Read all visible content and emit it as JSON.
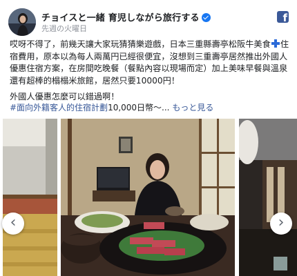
{
  "post": {
    "page_name": "チョイスと一緒 育児しながら旅行する",
    "time": "先週の火曜日",
    "facebook_logo_letter": "f",
    "body_part1": "哎呀不得了，前幾天讓大家玩猜猜樂遊戲，日本三重縣壽亭松阪牛美食",
    "body_part2": "住宿費用，原本以為每人兩萬円已經很便宜，沒想到三重壽亭居然推出外國人優惠住宿方案，在房間吃晚餐（餐點內容以現場而定）加上美味早餐與溫泉還有超棒的榻榻米旅館，居然只要10000円！",
    "body_line2": "外國人優惠怎麼可以錯過啊！",
    "hashtag": "#面向外籍客人的住宿計劃",
    "hashtag_after": "10,000日幣〜... ",
    "see_more": "もっと見る"
  },
  "gallery": {
    "prev_arrow": "‹",
    "next_arrow": "›"
  }
}
